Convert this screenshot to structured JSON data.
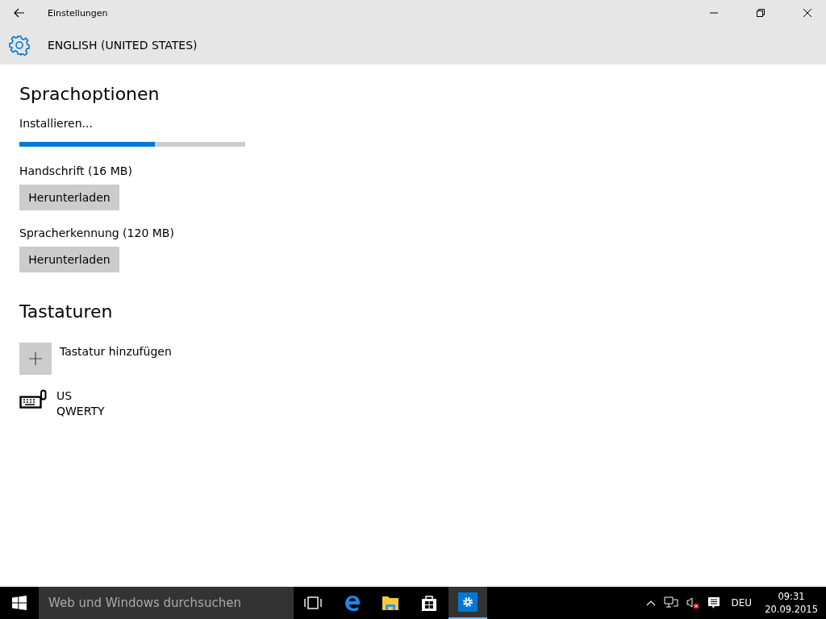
{
  "window": {
    "title": "Einstellungen"
  },
  "header": {
    "title": "ENGLISH (UNITED STATES)"
  },
  "section_language": {
    "heading": "Sprachoptionen",
    "progress": {
      "label": "Installieren...",
      "level": 0.6
    },
    "downloads": [
      {
        "label": "Handschrift (16 MB)",
        "button": "Herunterladen"
      },
      {
        "label": "Spracherkennung (120 MB)",
        "button": "Herunterladen"
      }
    ]
  },
  "section_keyboards": {
    "heading": "Tastaturen",
    "add_label": "Tastatur hinzufügen",
    "keyboards": [
      {
        "name": "US",
        "layout": "QWERTY"
      }
    ]
  },
  "taskbar": {
    "search_placeholder": "Web und Windows durchsuchen",
    "apps": [
      {
        "kind": "taskview",
        "selected": false
      },
      {
        "kind": "edge",
        "selected": false
      },
      {
        "kind": "explorer",
        "selected": false
      },
      {
        "kind": "store",
        "selected": false
      },
      {
        "kind": "settings",
        "selected": true
      }
    ],
    "language": "DEU",
    "time": "09:31",
    "date": "20.09.2015"
  }
}
